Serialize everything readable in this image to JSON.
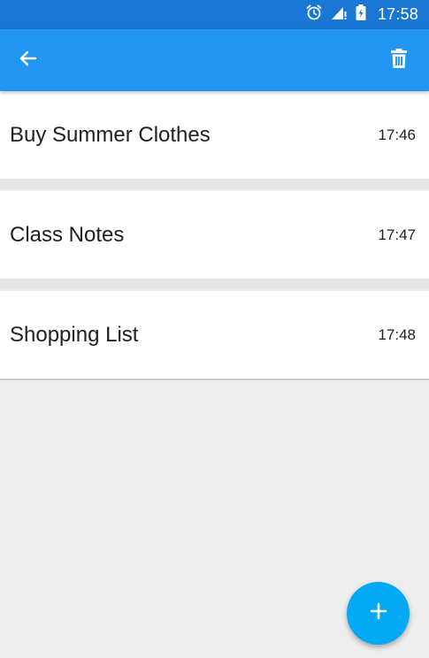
{
  "status_bar": {
    "time": "17:58",
    "icons": [
      "alarm-icon",
      "signal-icon",
      "battery-charging-icon"
    ]
  },
  "app_bar": {
    "back_icon": "arrow-back-icon",
    "delete_icon": "trash-icon"
  },
  "notes": [
    {
      "title": "Buy Summer Clothes",
      "time": "17:46"
    },
    {
      "title": "Class Notes",
      "time": "17:47"
    },
    {
      "title": "Shopping List",
      "time": "17:48"
    }
  ],
  "fab": {
    "icon": "plus-icon"
  },
  "colors": {
    "status_bar": "#1976d2",
    "app_bar": "#2196f3",
    "fab": "#03a9f4",
    "background": "#eeeeee"
  }
}
